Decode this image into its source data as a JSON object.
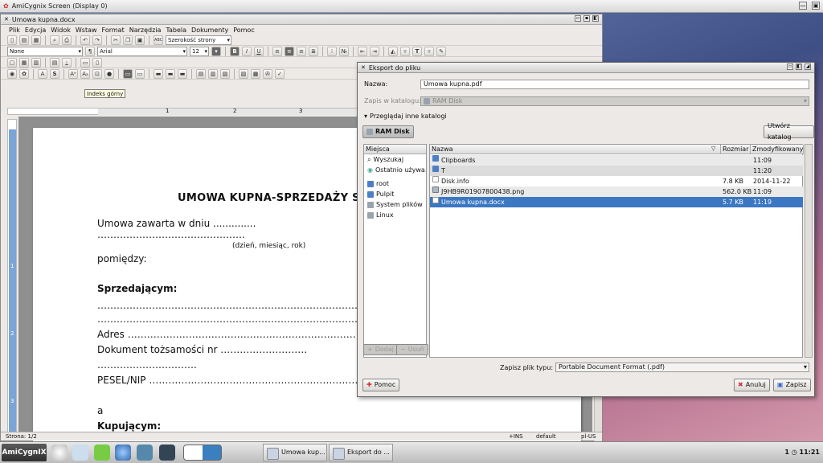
{
  "screen": {
    "title": "AmiCygnix Screen (Display 0)"
  },
  "writer": {
    "title": "Umowa kupna.docx",
    "menu": [
      "Plik",
      "Edycja",
      "Widok",
      "Wstaw",
      "Format",
      "Narzędzia",
      "Tabela",
      "Dokumenty",
      "Pomoc"
    ],
    "zoom": "Szerokość strony",
    "style": "None",
    "font": "Arial",
    "font_size": "12",
    "tooltip": "Indeks górny",
    "ruler_marks": [
      "1",
      "2",
      "3"
    ],
    "vruler_marks": [
      "1",
      "2",
      "3"
    ]
  },
  "document": {
    "title": "UMOWA KUPNA-SPRZEDAŻY S",
    "lines": [
      "Umowa           zawarta           w           dniu           ..............",
      "……………………………………….",
      "(dzień, miesiąc, rok)",
      "pomiędzy:",
      "Sprzedającym:",
      "…………………………………………………………………………………………………",
      "…………………………………………………………………………………………………",
      "Adres ………………………………………………………………………………",
      "Dokument      tożsamości      nr      ………………………",
      "………………………….",
      "PESEL/NIP …………………………………………………………………",
      "a",
      "Kupującym:"
    ]
  },
  "status": {
    "page": "Strona: 1/2",
    "mode": "+INS",
    "style": "default",
    "lang": "pl-US"
  },
  "dialog": {
    "title": "Eksport do pliku",
    "name_label": "Nazwa:",
    "name_value": "Umowa kupna.pdf",
    "folder_label": "Zapis w katalogu:",
    "folder_value": "RAM Disk",
    "browse_label": "Przeglądaj inne katalogi",
    "path_button": "RAM Disk",
    "create_folder": "Utwórz katalog",
    "places_header": "Miejsca",
    "places": [
      "Wyszukaj",
      "Ostatnio używa…",
      "root",
      "Pulpit",
      "System plików",
      "Linux"
    ],
    "add_button": "Dodaj",
    "remove_button": "Usuń",
    "columns": {
      "name": "Nazwa",
      "size": "Rozmiar",
      "modified": "Zmodyfikowany"
    },
    "files": [
      {
        "name": "Clipboards",
        "size": "",
        "modified": "11:09",
        "kind": "folder"
      },
      {
        "name": "T",
        "size": "",
        "modified": "11:20",
        "kind": "folder"
      },
      {
        "name": "Disk.info",
        "size": "7.8 KB",
        "modified": "2014-11-22",
        "kind": "file"
      },
      {
        "name": "J9HB9R01907800438.png",
        "size": "562.0 KB",
        "modified": "11:09",
        "kind": "img"
      },
      {
        "name": "Umowa kupna.docx",
        "size": "5.7 KB",
        "modified": "11:19",
        "kind": "file"
      }
    ],
    "filetype_label": "Zapisz plik typu:",
    "filetype_value": "Portable Document Format (.pdf)",
    "help_button": "Pomoc",
    "cancel_button": "Anuluj",
    "save_button": "Zapisz"
  },
  "taskbar": {
    "start": "AmiCygnIX",
    "tasks": [
      "Umowa kup...",
      "Eksport do ..."
    ],
    "workspace": "1",
    "clock": "11:21"
  }
}
